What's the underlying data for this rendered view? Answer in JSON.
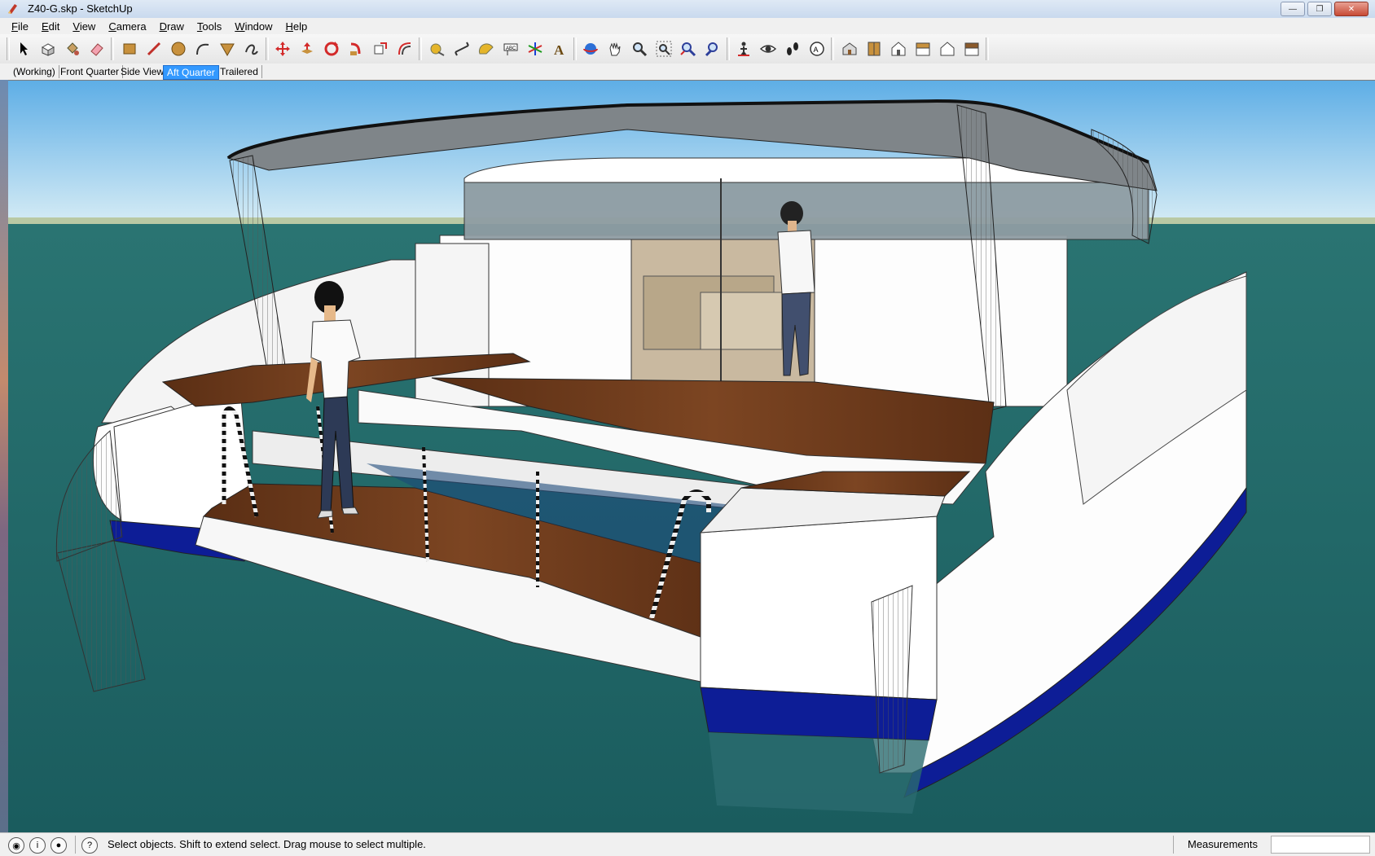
{
  "window": {
    "title": "Z40-G.skp - SketchUp",
    "controls": [
      "minimize",
      "maximize",
      "close"
    ]
  },
  "menu": [
    "File",
    "Edit",
    "View",
    "Camera",
    "Draw",
    "Tools",
    "Window",
    "Help"
  ],
  "toolbar": {
    "tools": [
      "select-icon",
      "make-component-icon",
      "paint-bucket-icon",
      "eraser-icon",
      "rectangle-icon",
      "line-icon",
      "circle-icon",
      "arc-icon",
      "polygon-icon",
      "freehand-icon",
      "move-icon",
      "push-pull-icon",
      "rotate-icon",
      "follow-me-icon",
      "scale-icon",
      "offset-icon",
      "tape-measure-icon",
      "dimension-icon",
      "protractor-icon",
      "text-icon",
      "axes-icon",
      "3d-text-icon",
      "orbit-icon",
      "pan-icon",
      "zoom-icon",
      "zoom-window-icon",
      "zoom-extents-icon",
      "previous-view-icon",
      "position-camera-icon",
      "look-around-icon",
      "walk-icon",
      "section-plane-icon",
      "iso-view-icon",
      "top-view-icon",
      "front-view-icon",
      "right-view-icon",
      "back-view-icon",
      "left-view-icon"
    ]
  },
  "scenes": {
    "tabs": [
      "(Working)",
      "Front Quarter",
      "Side View",
      "Aft Quarter",
      "Trailered"
    ],
    "active": "Aft Quarter"
  },
  "status": {
    "hint": "Select objects. Shift to extend select. Drag mouse to select multiple.",
    "measurements_label": "Measurements",
    "measurements_value": ""
  },
  "colors": {
    "sky_top": "#6bb6e8",
    "sky_horizon": "#cfe7f3",
    "water": "#1e6767",
    "hull": "#ffffff",
    "boot_stripe": "#0a1a8f",
    "teak": "#6b3a1c",
    "active_tab": "#3399ff"
  }
}
